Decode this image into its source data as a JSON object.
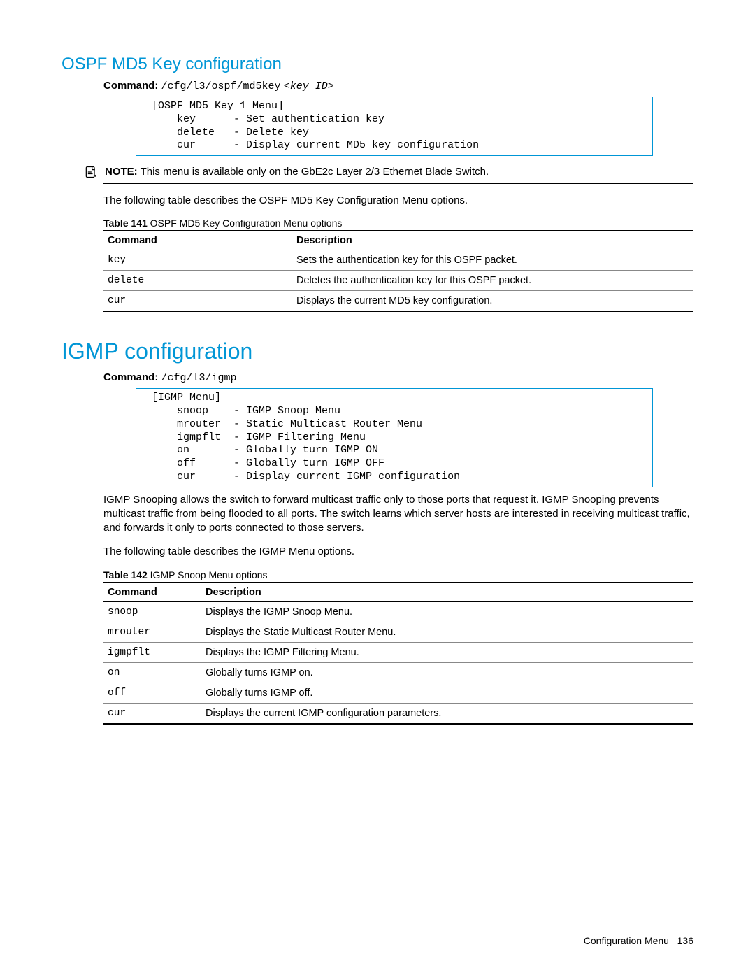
{
  "section1": {
    "heading": "OSPF MD5 Key configuration",
    "command_label": "Command:",
    "command_value": "/cfg/l3/ospf/md5key",
    "command_args": "<key ID>",
    "code": "[OSPF MD5 Key 1 Menu]\n    key      - Set authentication key\n    delete   - Delete key\n    cur      - Display current MD5 key configuration",
    "note_label": "NOTE:",
    "note_text": "This menu is available only on the GbE2c Layer 2/3 Ethernet Blade Switch.",
    "intro": "The following table describes the OSPF MD5 Key Configuration Menu options.",
    "table_tag": "Table 141",
    "table_title": " OSPF MD5 Key Configuration Menu options",
    "th_cmd": "Command",
    "th_desc": "Description",
    "rows": [
      {
        "cmd": "key",
        "desc": "Sets the authentication key for this OSPF packet."
      },
      {
        "cmd": "delete",
        "desc": "Deletes the authentication key for this OSPF packet."
      },
      {
        "cmd": "cur",
        "desc": "Displays the current MD5 key configuration."
      }
    ]
  },
  "section2": {
    "heading": "IGMP configuration",
    "command_label": "Command:",
    "command_value": "/cfg/l3/igmp",
    "code": "[IGMP Menu]\n    snoop    - IGMP Snoop Menu\n    mrouter  - Static Multicast Router Menu\n    igmpflt  - IGMP Filtering Menu\n    on       - Globally turn IGMP ON\n    off      - Globally turn IGMP OFF\n    cur      - Display current IGMP configuration",
    "para1": "IGMP Snooping allows the switch to forward multicast traffic only to those ports that request it. IGMP Snooping prevents multicast traffic from being flooded to all ports. The switch learns which server hosts are interested in receiving multicast traffic, and forwards it only to ports connected to those servers.",
    "para2": "The following table describes the IGMP Menu options.",
    "table_tag": "Table 142",
    "table_title": " IGMP Snoop Menu options",
    "th_cmd": "Command",
    "th_desc": "Description",
    "rows": [
      {
        "cmd": "snoop",
        "desc": "Displays the IGMP Snoop Menu."
      },
      {
        "cmd": "mrouter",
        "desc": "Displays the Static Multicast Router Menu."
      },
      {
        "cmd": "igmpflt",
        "desc": "Displays the IGMP Filtering Menu."
      },
      {
        "cmd": "on",
        "desc": "Globally turns IGMP on."
      },
      {
        "cmd": "off",
        "desc": "Globally turns IGMP off."
      },
      {
        "cmd": "cur",
        "desc": "Displays the current IGMP configuration parameters."
      }
    ]
  },
  "footer": {
    "label": "Configuration Menu",
    "page": "136"
  }
}
